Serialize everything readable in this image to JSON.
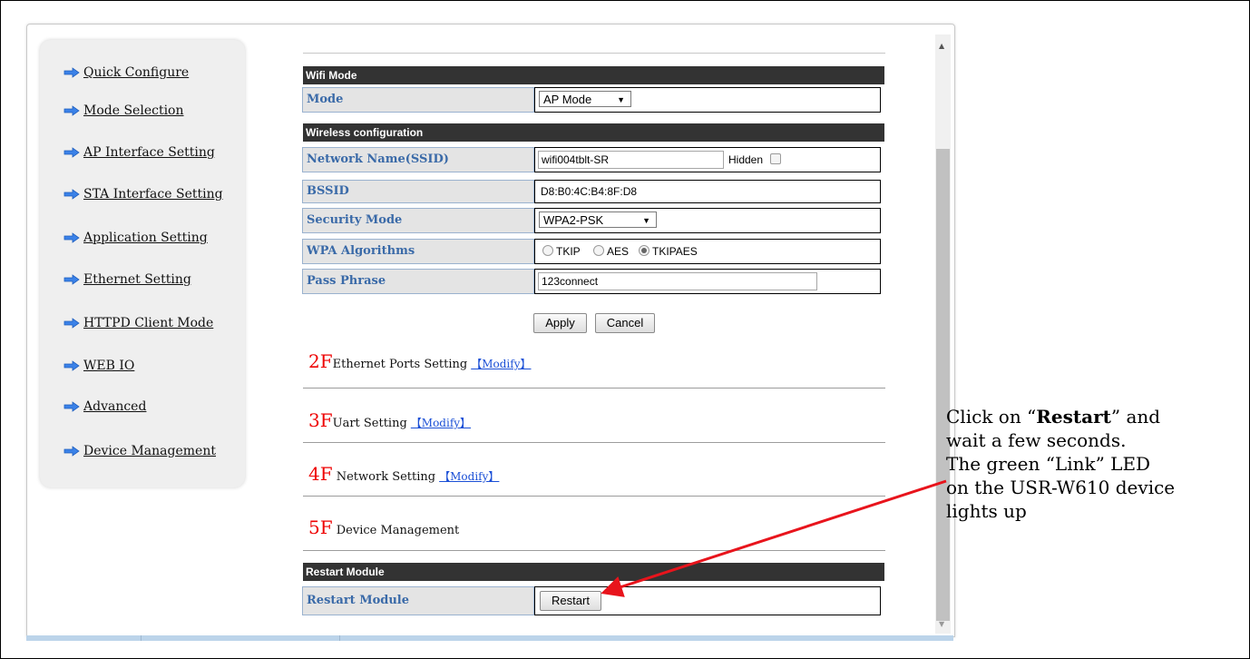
{
  "sidebar": {
    "items": [
      {
        "label": "Quick Configure"
      },
      {
        "label": "Mode Selection"
      },
      {
        "label": "AP Interface Setting"
      },
      {
        "label": "STA Interface Setting"
      },
      {
        "label": "Application Setting"
      },
      {
        "label": "Ethernet Setting"
      },
      {
        "label": "HTTPD Client Mode"
      },
      {
        "label": "WEB IO"
      },
      {
        "label": "Advanced"
      },
      {
        "label": "Device Management"
      }
    ]
  },
  "wifi_mode": {
    "header": "Wifi Mode",
    "mode_label": "Mode",
    "mode_value": "AP Mode"
  },
  "wireless": {
    "header": "Wireless configuration",
    "ssid_label": "Network Name(SSID)",
    "ssid_value": "wifi004tblt-SR",
    "hidden_label": "Hidden",
    "bssid_label": "BSSID",
    "bssid_value": "D8:B0:4C:B4:8F:D8",
    "security_label": "Security Mode",
    "security_value": "WPA2-PSK",
    "wpa_label": "WPA Algorithms",
    "wpa_options": [
      "TKIP",
      "AES",
      "TKIPAES"
    ],
    "wpa_selected": "TKIPAES",
    "pass_label": "Pass Phrase",
    "pass_value": "123connect"
  },
  "buttons": {
    "apply": "Apply",
    "cancel": "Cancel",
    "restart": "Restart"
  },
  "floors": [
    {
      "num": "2F",
      "title": "Ethernet Ports Setting",
      "modify": "【Modify】"
    },
    {
      "num": "3F",
      "title": "Uart Setting",
      "modify": "【Modify】"
    },
    {
      "num": "4F",
      "title": " Network Setting",
      "modify": "【Modify】"
    },
    {
      "num": "5F",
      "title": " Device Management",
      "modify": ""
    }
  ],
  "restart": {
    "header": "Restart Module",
    "label": "Restart Module"
  },
  "annotation": {
    "line1_pre": "Click on “",
    "line1_bold": "Restart",
    "line1_post": "” and",
    "line2": "wait a few seconds.",
    "line3": "The green “Link” LED",
    "line4": "on the USR-W610 device",
    "line5": "lights up",
    "arrow_color": "#e8141c"
  },
  "colors": {
    "header_bg": "#333333",
    "label_text": "#3a6aa8",
    "floor_number": "#ee0000",
    "link": "#1a4fd6",
    "sidebar_arrow": "#3b82e8"
  }
}
